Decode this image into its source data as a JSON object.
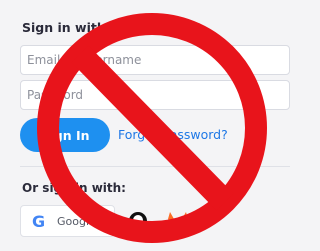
{
  "login": {
    "heading": "Sign in with your account",
    "email_placeholder": "Email or Username",
    "password_placeholder": "Password",
    "signin_label": "Sign In",
    "forgot_label": "Forgot password?",
    "social_heading": "Or sign in with:",
    "google_label": "Google",
    "google_glyph": "G"
  },
  "overlay": {
    "icon": "prohibited-sign-icon",
    "color": "#e8141b"
  },
  "colors": {
    "accent": "#1e90f0",
    "link": "#1e78e6"
  }
}
